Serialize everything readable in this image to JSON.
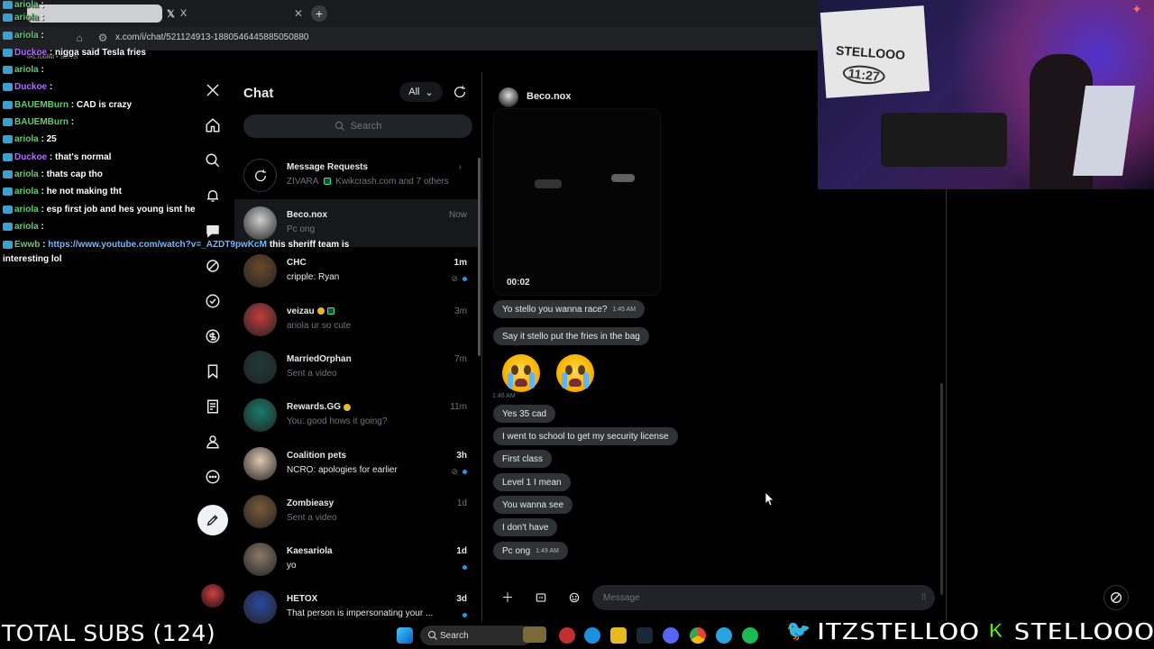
{
  "browser": {
    "active_tab_label": "",
    "inactive_tab_label": "X",
    "new_tab": "+",
    "url": "x.com/i/chat/521124913-1880546445885050880",
    "extension_label": "IRLToolkit • Server"
  },
  "overlay_chat": [
    {
      "user": "ariola",
      "sep": " : ",
      "msg": "",
      "color": "#5ccf6c"
    },
    {
      "user": "ariola",
      "sep": " : ",
      "msg": "",
      "color": "#5ccf6c"
    },
    {
      "user": "ariola",
      "sep": " : ",
      "msg": "",
      "color": "#5ccf6c"
    },
    {
      "user": "Duckoe",
      "sep": " : ",
      "msg": "nigga said Tesla fries",
      "color": "#b46cff"
    },
    {
      "user": "ariola",
      "sep": " : ",
      "msg": "",
      "color": "#5ccf6c"
    },
    {
      "user": "Duckoe",
      "sep": " : ",
      "msg": "",
      "color": "#b46cff"
    },
    {
      "user": "BAUEMBurn",
      "sep": " : ",
      "msg": "CAD is crazy",
      "color": "#5ccf6c"
    },
    {
      "user": "BAUEMBurn",
      "sep": " : ",
      "msg": "",
      "color": "#5ccf6c"
    },
    {
      "user": "ariola",
      "sep": " : ",
      "msg": "25",
      "color": "#5ccf6c"
    },
    {
      "user": "Duckoe",
      "sep": " : ",
      "msg": "that's normal",
      "color": "#b46cff"
    },
    {
      "user": "ariola",
      "sep": " : ",
      "msg": "thats cap tho",
      "color": "#5ccf6c"
    },
    {
      "user": "ariola",
      "sep": " : ",
      "msg": "he not making tht",
      "color": "#5ccf6c"
    },
    {
      "user": "ariola",
      "sep": " : ",
      "msg": "esp first job and hes young isnt he",
      "color": "#5ccf6c"
    },
    {
      "user": "ariola",
      "sep": " : ",
      "msg": "",
      "color": "#5ccf6c"
    },
    {
      "user": "Ewwb",
      "sep": " : ",
      "msg": "https://www.youtube.com/watch?v=_AZDT9pwKcM",
      "msg2": "this sheriff team is",
      "color": "#5ccf6c"
    }
  ],
  "overlay_chat_tail": "interesting lol",
  "nav": {
    "items": [
      "x-logo",
      "home",
      "search",
      "notifications",
      "messages",
      "grok",
      "verified",
      "premium",
      "bookmarks",
      "lists",
      "profile",
      "more"
    ]
  },
  "chat_list": {
    "title": "Chat",
    "filter": "All",
    "search_placeholder": "Search",
    "requests": {
      "title": "Message Requests",
      "subtitle": "ZIVARA",
      "subtitle2": ", Kwikcrash.com and 7 others"
    },
    "conversations": [
      {
        "name": "Beco.nox",
        "preview": "Pc ong",
        "time": "Now",
        "unread": false,
        "active": true,
        "avatar": "#cfcfcf"
      },
      {
        "name": "CHC",
        "preview": "cripple: Ryan",
        "time": "1m",
        "unread": true,
        "muted": true,
        "avatar": "#6b4a2a"
      },
      {
        "name": "veizau",
        "preview": "ariola ur so cute",
        "time": "3m",
        "unread": false,
        "verified": true,
        "badge": true,
        "avatar": "#c43d3d"
      },
      {
        "name": "MarriedOrphan",
        "preview": "Sent a video",
        "time": "7m",
        "unread": false,
        "avatar": "#1f3a3a"
      },
      {
        "name": "Rewards.GG",
        "preview": "You: good hows it going?",
        "time": "11m",
        "unread": false,
        "verified": true,
        "avatar": "#1a7a6a"
      },
      {
        "name": "Coalition pets",
        "preview": "NCRO: apologies for earlier",
        "time": "3h",
        "unread": true,
        "muted": true,
        "avatar": "#e0c8b0"
      },
      {
        "name": "Zombieasy",
        "preview": "Sent a video",
        "time": "1d",
        "unread": false,
        "avatar": "#7a5a3a"
      },
      {
        "name": "Kaesariola",
        "preview": "yo",
        "time": "1d",
        "unread": true,
        "avatar": "#8a7a6a"
      },
      {
        "name": "HETOX",
        "preview": "That person is impersonating your ...",
        "time": "3d",
        "unread": true,
        "avatar": "#2a4aa0"
      }
    ]
  },
  "conversation": {
    "name": "Beco.nox",
    "video_duration": "00:02",
    "messages": [
      {
        "text": "Yo stello you wanna race?",
        "ts": "1:45 AM"
      },
      {
        "text": "Say it stello put the fries in the bag",
        "ts": ""
      },
      {
        "text": "Yes 35 cad",
        "ts": ""
      },
      {
        "text": "I went to school to get my security license",
        "ts": ""
      },
      {
        "text": "First class",
        "ts": ""
      },
      {
        "text": "Level 1 I mean",
        "ts": ""
      },
      {
        "text": "You wanna see",
        "ts": ""
      },
      {
        "text": "I don't have",
        "ts": ""
      },
      {
        "text": "Pc ong",
        "ts": "1:49 AM"
      }
    ],
    "emoji_ts": "1:46 AM",
    "input_placeholder": "Message"
  },
  "webcam": {
    "sign_text": "STELLOOO",
    "sign_sub": "11:27"
  },
  "stream_overlay": {
    "total_subs": "TOTAL SUBS (124)",
    "twitter_handle": "ITZSTELLOO",
    "kick_handle": "STELLOOO"
  },
  "taskbar": {
    "search_label": "Search"
  }
}
